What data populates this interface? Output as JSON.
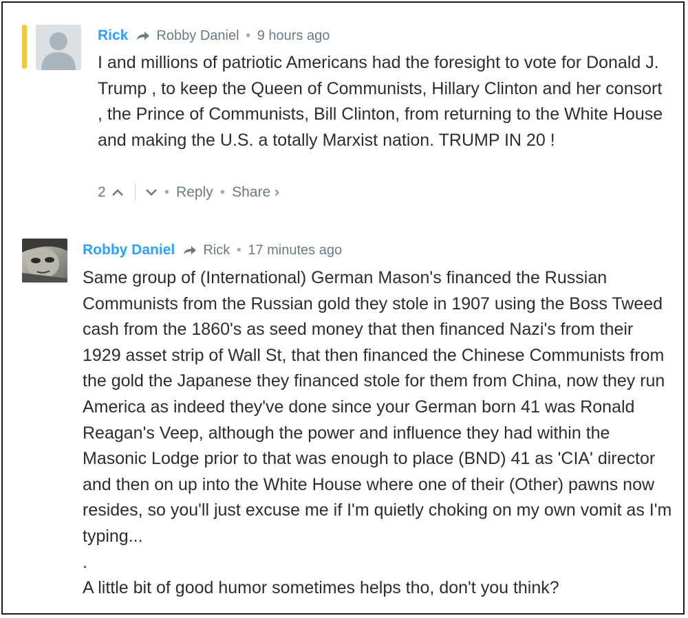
{
  "comments": [
    {
      "author": "Rick",
      "reply_to": "Robby Daniel",
      "time": "9 hours ago",
      "body": [
        "I and millions of patriotic Americans had the foresight to vote for Donald J. Trump , to keep the Queen of Communists, Hillary Clinton and her consort , the Prince of Communists, Bill Clinton, from returning to the White House and making the U.S. a totally Marxist nation. TRUMP IN 20 !"
      ],
      "votes": "2",
      "reply_label": "Reply",
      "share_label": "Share ›"
    },
    {
      "author": "Robby Daniel",
      "reply_to": "Rick",
      "time": "17 minutes ago",
      "body": [
        "Same group of (International) German Mason's financed the Russian Communists from the Russian gold they stole in 1907 using the Boss Tweed cash from the 1860's as seed money that then financed Nazi's from their 1929 asset strip of Wall St, that then financed the Chinese Communists from the gold the Japanese they financed stole for them from China, now they run America as indeed they've done since your German born 41 was Ronald Reagan's Veep, although the power and influence they had within the Masonic Lodge prior to that was enough to place (BND) 41 as 'CIA' director and then on up into the White House where one of their (Other) pawns now resides, so you'll just excuse me if I'm quietly choking on my own vomit as I'm typing...",
        ".",
        "A little bit of good humor sometimes helps tho, don't you think?"
      ]
    }
  ],
  "separator_dot": "•",
  "icons": {
    "default_avatar": "user-silhouette-icon",
    "reply_arrow": "reply-arrow-icon",
    "upvote": "chevron-up-icon",
    "downvote": "chevron-down-icon"
  },
  "colors": {
    "author": "#2e9fff",
    "highlight": "#f5c63a",
    "meta": "#687a86"
  }
}
